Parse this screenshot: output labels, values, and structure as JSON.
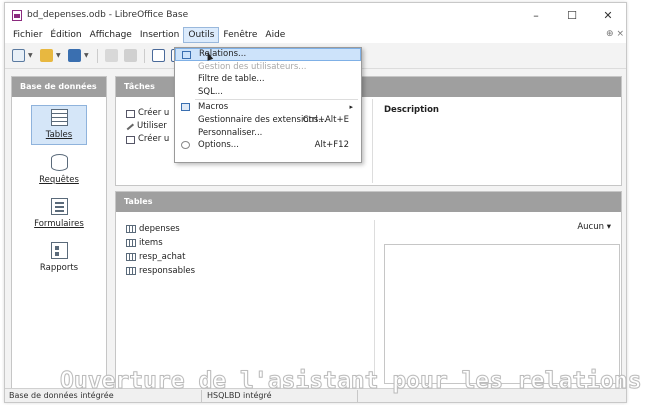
{
  "window": {
    "title": "bd_depenses.odb - LibreOffice Base",
    "controls": {
      "minimize": "–",
      "maximize": "☐",
      "close": "✕"
    }
  },
  "menubar": {
    "items": [
      "Fichier",
      "Édition",
      "Affichage",
      "Insertion",
      "Outils",
      "Fenêtre",
      "Aide"
    ],
    "open_item": "Outils",
    "help_glyph": "⊕ ×"
  },
  "outils_menu": {
    "items": [
      {
        "label": "Relations...",
        "highlighted": true,
        "disabled": false,
        "shortcut": ""
      },
      {
        "label": "Gestion des utilisateurs...",
        "disabled": true,
        "shortcut": ""
      },
      {
        "label": "Filtre de table...",
        "disabled": false,
        "shortcut": ""
      },
      {
        "label": "SQL...",
        "disabled": false,
        "shortcut": ""
      },
      {
        "label": "Macros",
        "disabled": false,
        "shortcut": "",
        "submenu": true
      },
      {
        "label": "Gestionnaire des extensions...",
        "disabled": false,
        "shortcut": "Ctrl+Alt+E"
      },
      {
        "label": "Personnaliser...",
        "disabled": false,
        "shortcut": ""
      },
      {
        "label": "Options...",
        "disabled": false,
        "shortcut": "Alt+F12"
      }
    ]
  },
  "left_pane": {
    "header": "Base de données",
    "items": [
      {
        "label": "Tables",
        "selected": true
      },
      {
        "label": "Requêtes",
        "selected": false
      },
      {
        "label": "Formulaires",
        "selected": false
      },
      {
        "label": "Rapports",
        "selected": false
      }
    ]
  },
  "tasks_pane": {
    "header": "Tâches",
    "tasks": [
      "Créer u",
      "Utiliser",
      "Créer u"
    ],
    "description_title": "Description"
  },
  "tables_pane": {
    "header": "Tables",
    "tables": [
      "depenses",
      "items",
      "resp_achat",
      "responsables"
    ],
    "preview_option": "Aucun"
  },
  "statusbar": {
    "left": "Base de données intégrée",
    "middle": "HSQLBD intégré"
  },
  "caption": "Ouverture de l'asistant pour les relations",
  "colors": {
    "header_bg": "#9f9f9f",
    "highlight": "#cde3fa",
    "selected": "#d5e6f8"
  }
}
